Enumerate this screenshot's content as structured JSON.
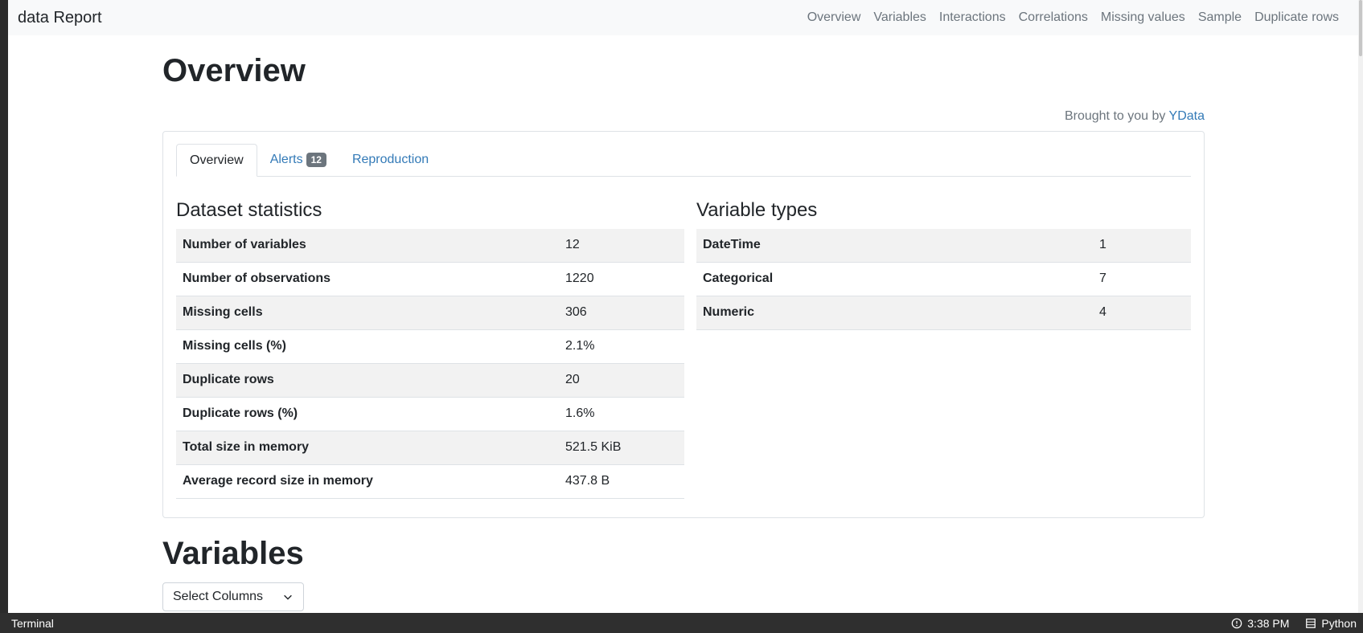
{
  "navbar": {
    "brand": "data Report",
    "links": [
      "Overview",
      "Variables",
      "Interactions",
      "Correlations",
      "Missing values",
      "Sample",
      "Duplicate rows"
    ]
  },
  "page": {
    "title": "Overview",
    "credit_prefix": "Brought to you by ",
    "credit_link": "YData"
  },
  "tabs": [
    {
      "label": "Overview"
    },
    {
      "label": "Alerts",
      "badge": "12"
    },
    {
      "label": "Reproduction"
    }
  ],
  "dataset_statistics": {
    "title": "Dataset statistics",
    "rows": [
      {
        "label": "Number of variables",
        "value": "12"
      },
      {
        "label": "Number of observations",
        "value": "1220"
      },
      {
        "label": "Missing cells",
        "value": "306"
      },
      {
        "label": "Missing cells (%)",
        "value": "2.1%"
      },
      {
        "label": "Duplicate rows",
        "value": "20"
      },
      {
        "label": "Duplicate rows (%)",
        "value": "1.6%"
      },
      {
        "label": "Total size in memory",
        "value": "521.5 KiB"
      },
      {
        "label": "Average record size in memory",
        "value": "437.8 B"
      }
    ]
  },
  "variable_types": {
    "title": "Variable types",
    "rows": [
      {
        "label": "DateTime",
        "value": "1"
      },
      {
        "label": "Categorical",
        "value": "7"
      },
      {
        "label": "Numeric",
        "value": "4"
      }
    ]
  },
  "variables": {
    "title": "Variables",
    "select_label": "Select Columns"
  },
  "taskbar": {
    "terminal": "Terminal",
    "time": "3:38 PM",
    "python": "Python"
  },
  "icons": {
    "select": "chevron-down-icon",
    "terminal": "terminal-icon",
    "clock": "clock-icon",
    "python": "python-icon"
  },
  "colors": {
    "link": "#337ab7",
    "muted": "#6c757d",
    "stripe": "#f2f2f2"
  }
}
